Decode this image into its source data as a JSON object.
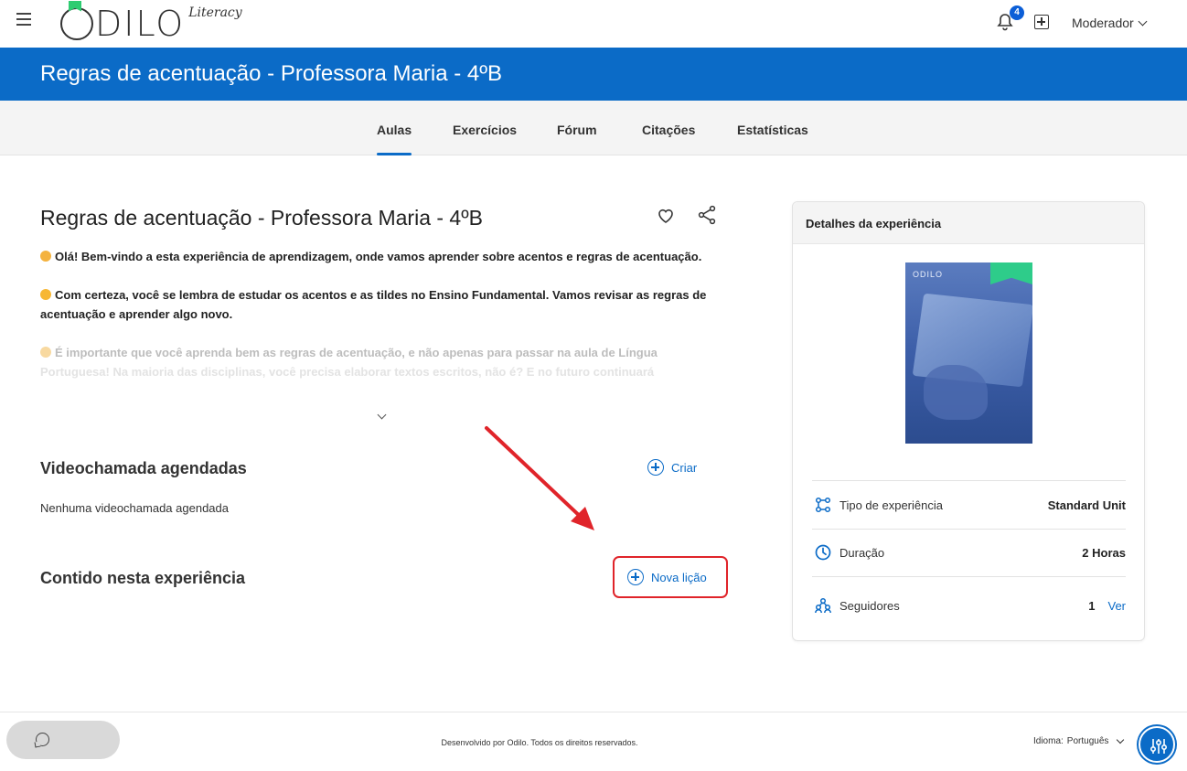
{
  "app": {
    "logo_word": "DILO",
    "logo_tag": "Literacy",
    "notifications_count": "4",
    "user_name": "Moderador"
  },
  "banner": {
    "title": "Regras de acentuação - Professora Maria - 4ºB"
  },
  "tabs": [
    {
      "label": "Aulas",
      "active": true
    },
    {
      "label": "Exercícios",
      "active": false
    },
    {
      "label": "Fórum",
      "active": false
    },
    {
      "label": "Citações",
      "active": false
    },
    {
      "label": "Estatísticas",
      "active": false
    }
  ],
  "experience": {
    "title": "Regras de acentuação - Professora Maria - 4ºB",
    "paragraphs": [
      "Olá! Bem-vindo a esta experiência de aprendizagem, onde vamos aprender sobre acentos e regras de acentuação.",
      "Com certeza, você se lembra de estudar os acentos e as tildes no Ensino Fundamental. Vamos revisar as regras de acentuação e aprender algo novo.",
      "É importante que você aprenda bem as regras de acentuação, e não apenas para passar na aula de Língua",
      "Portuguesa! Na maioria das disciplinas, você precisa elaborar textos escritos, não é? E no futuro continuará"
    ]
  },
  "videocalls": {
    "title": "Videochamada agendadas",
    "create_label": "Criar",
    "empty_text": "Nenhuma videochamada agendada"
  },
  "content": {
    "title": "Contido nesta experiência",
    "new_lesson_label": "Nova lição"
  },
  "details": {
    "header": "Detalhes da experiência",
    "cover_brand": "ODILO",
    "rows": [
      {
        "label": "Tipo de experiência",
        "value": "Standard Unit"
      },
      {
        "label": "Duração",
        "value": "2 Horas"
      },
      {
        "label": "Seguidores",
        "value": "1",
        "link": "Ver"
      }
    ]
  },
  "footer": {
    "copyright": "Desenvolvido por Odilo. Todos os direitos reservados.",
    "language_label": "Idioma:",
    "language_value": "Português"
  },
  "colors": {
    "brand_blue": "#0b6bc7",
    "highlight_red": "#e0242a",
    "bookmark_green": "#2ecc8a"
  },
  "icons": [
    "menu-icon",
    "bell-icon",
    "plus-square-icon",
    "chevron-down-icon",
    "heart-icon",
    "share-icon",
    "plus-circle-icon",
    "experience-type-icon",
    "clock-icon",
    "followers-icon",
    "chat-icon",
    "accessibility-icon"
  ]
}
